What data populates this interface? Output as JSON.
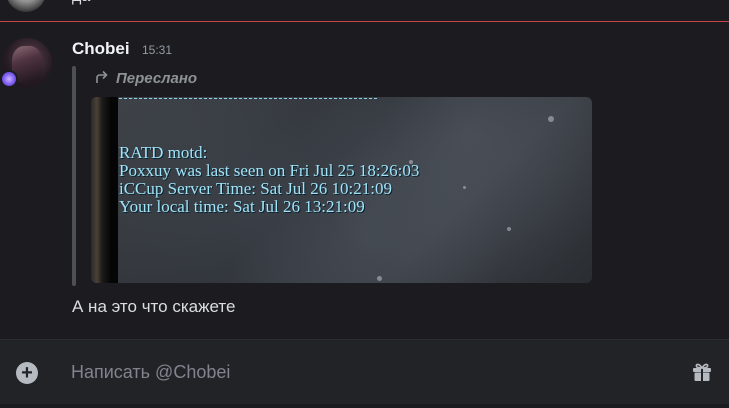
{
  "previous_message": {
    "text": "да"
  },
  "message": {
    "author": "Chobei",
    "timestamp": "15:31",
    "forwarded_label": "Переслано",
    "text": "А на это что скажете",
    "embedded_image": {
      "lines": [
        "RATD motd:",
        "Poxxuy was last seen on Fri Jul 25 18:26:03",
        "iCCup Server Time: Sat Jul 26 10:21:09",
        "Your local time: Sat Jul 26 13:21:09"
      ]
    }
  },
  "composer": {
    "placeholder": "Написать @Chobei"
  },
  "icons": {
    "forward": "forward-arrow-icon",
    "attach": "plus-circle-icon",
    "gift": "gift-icon"
  },
  "colors": {
    "background": "#1c1c20",
    "new_message_divider": "#c8414b",
    "game_text": "#9fe4f7"
  }
}
